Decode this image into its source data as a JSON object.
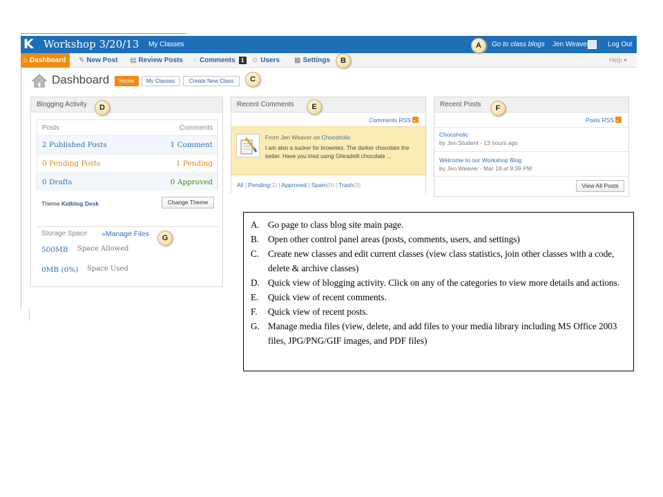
{
  "topbar": {
    "logo": "K",
    "site_title": "Workshop 3/20/13",
    "my_classes": "My Classes",
    "go_class_blogs": "Go to class blogs",
    "user_name": "Jen Weaver",
    "logout": "Log Out"
  },
  "nav": {
    "items": [
      {
        "label": "Dashboard",
        "icon": "home-icon"
      },
      {
        "label": "New Post",
        "icon": "pin-icon"
      },
      {
        "label": "Review Posts",
        "icon": "pages-icon"
      },
      {
        "label": "Comments",
        "icon": "comment-bubble-icon",
        "badge": "1"
      },
      {
        "label": "Users",
        "icon": "users-icon"
      },
      {
        "label": "Settings",
        "icon": "settings-icon"
      }
    ],
    "help": "Help ▾"
  },
  "header": {
    "title": "Dashboard",
    "buttons": [
      "Home",
      "My Classes",
      "Create New Class"
    ]
  },
  "blogging_activity": {
    "title": "Blogging Activity",
    "col_posts": "Posts",
    "col_comments": "Comments",
    "rows": [
      {
        "posts": "2 Published Posts",
        "comments": "1 Comment"
      },
      {
        "posts": "0 Pending Posts",
        "comments": "1 Pending"
      },
      {
        "posts": "0 Drafts",
        "comments": "0 Approved"
      }
    ],
    "theme_prefix": "Theme",
    "theme_name": "Kidblog Desk",
    "change_theme": "Change Theme"
  },
  "storage": {
    "label": "Storage Space",
    "manage": "»Manage Files",
    "allowed_value": "500MB",
    "allowed_label": "Space Allowed",
    "used_value": "0MB (0%)",
    "used_label": "Space Used"
  },
  "recent_comments": {
    "title": "Recent Comments",
    "rss": "Comments RSS",
    "from_prefix": "From Jen Weaver on",
    "post": "Chocoholic",
    "text": "I am also a sucker for brownies. The darker chocolate the better. Have you tried using Ghiradelli chocolate ...",
    "filters": {
      "all": "All",
      "pending": "Pending",
      "pending_count": "(1)",
      "approved": "Approved",
      "spam": "Spam",
      "spam_count": "(0)",
      "trash": "Trash",
      "trash_count": "(0)",
      "sep": "|"
    }
  },
  "recent_posts": {
    "title": "Recent Posts",
    "rss": "Posts RSS",
    "posts": [
      {
        "title": "Chocoholic",
        "meta": "by Jen Student - 13 hours ago"
      },
      {
        "title": "Welcome to our Workshop Blog",
        "meta": "by Jen Weaver - Mar 18 at 9:39 PM"
      }
    ],
    "view_all": "View All Posts"
  },
  "callouts": [
    "A",
    "B",
    "C",
    "D",
    "E",
    "F",
    "G"
  ],
  "legend": [
    {
      "letter": "A.",
      "text": "Go page to class blog site main page."
    },
    {
      "letter": "B.",
      "text": "Open other control panel areas (posts, comments, users, and settings)"
    },
    {
      "letter": "C.",
      "text": "Create new classes and edit current classes (view class statistics, join other classes with a code, delete & archive classes)"
    },
    {
      "letter": "D.",
      "text": "Quick view of blogging activity.  Click on any of the categories to view more details and actions."
    },
    {
      "letter": "E.",
      "text": "Quick view of recent comments."
    },
    {
      "letter": "F.",
      "text": "Quick view of recent posts."
    },
    {
      "letter": "G.",
      "text": "Manage media files (view, delete, and add files to your media library including MS Office 2003 files, JPG/PNG/GIF images, and PDF files)"
    }
  ],
  "colors": {
    "topbar": "#1e6fb8",
    "accent_orange": "#f08c13",
    "link_blue": "#2f6fb5"
  }
}
